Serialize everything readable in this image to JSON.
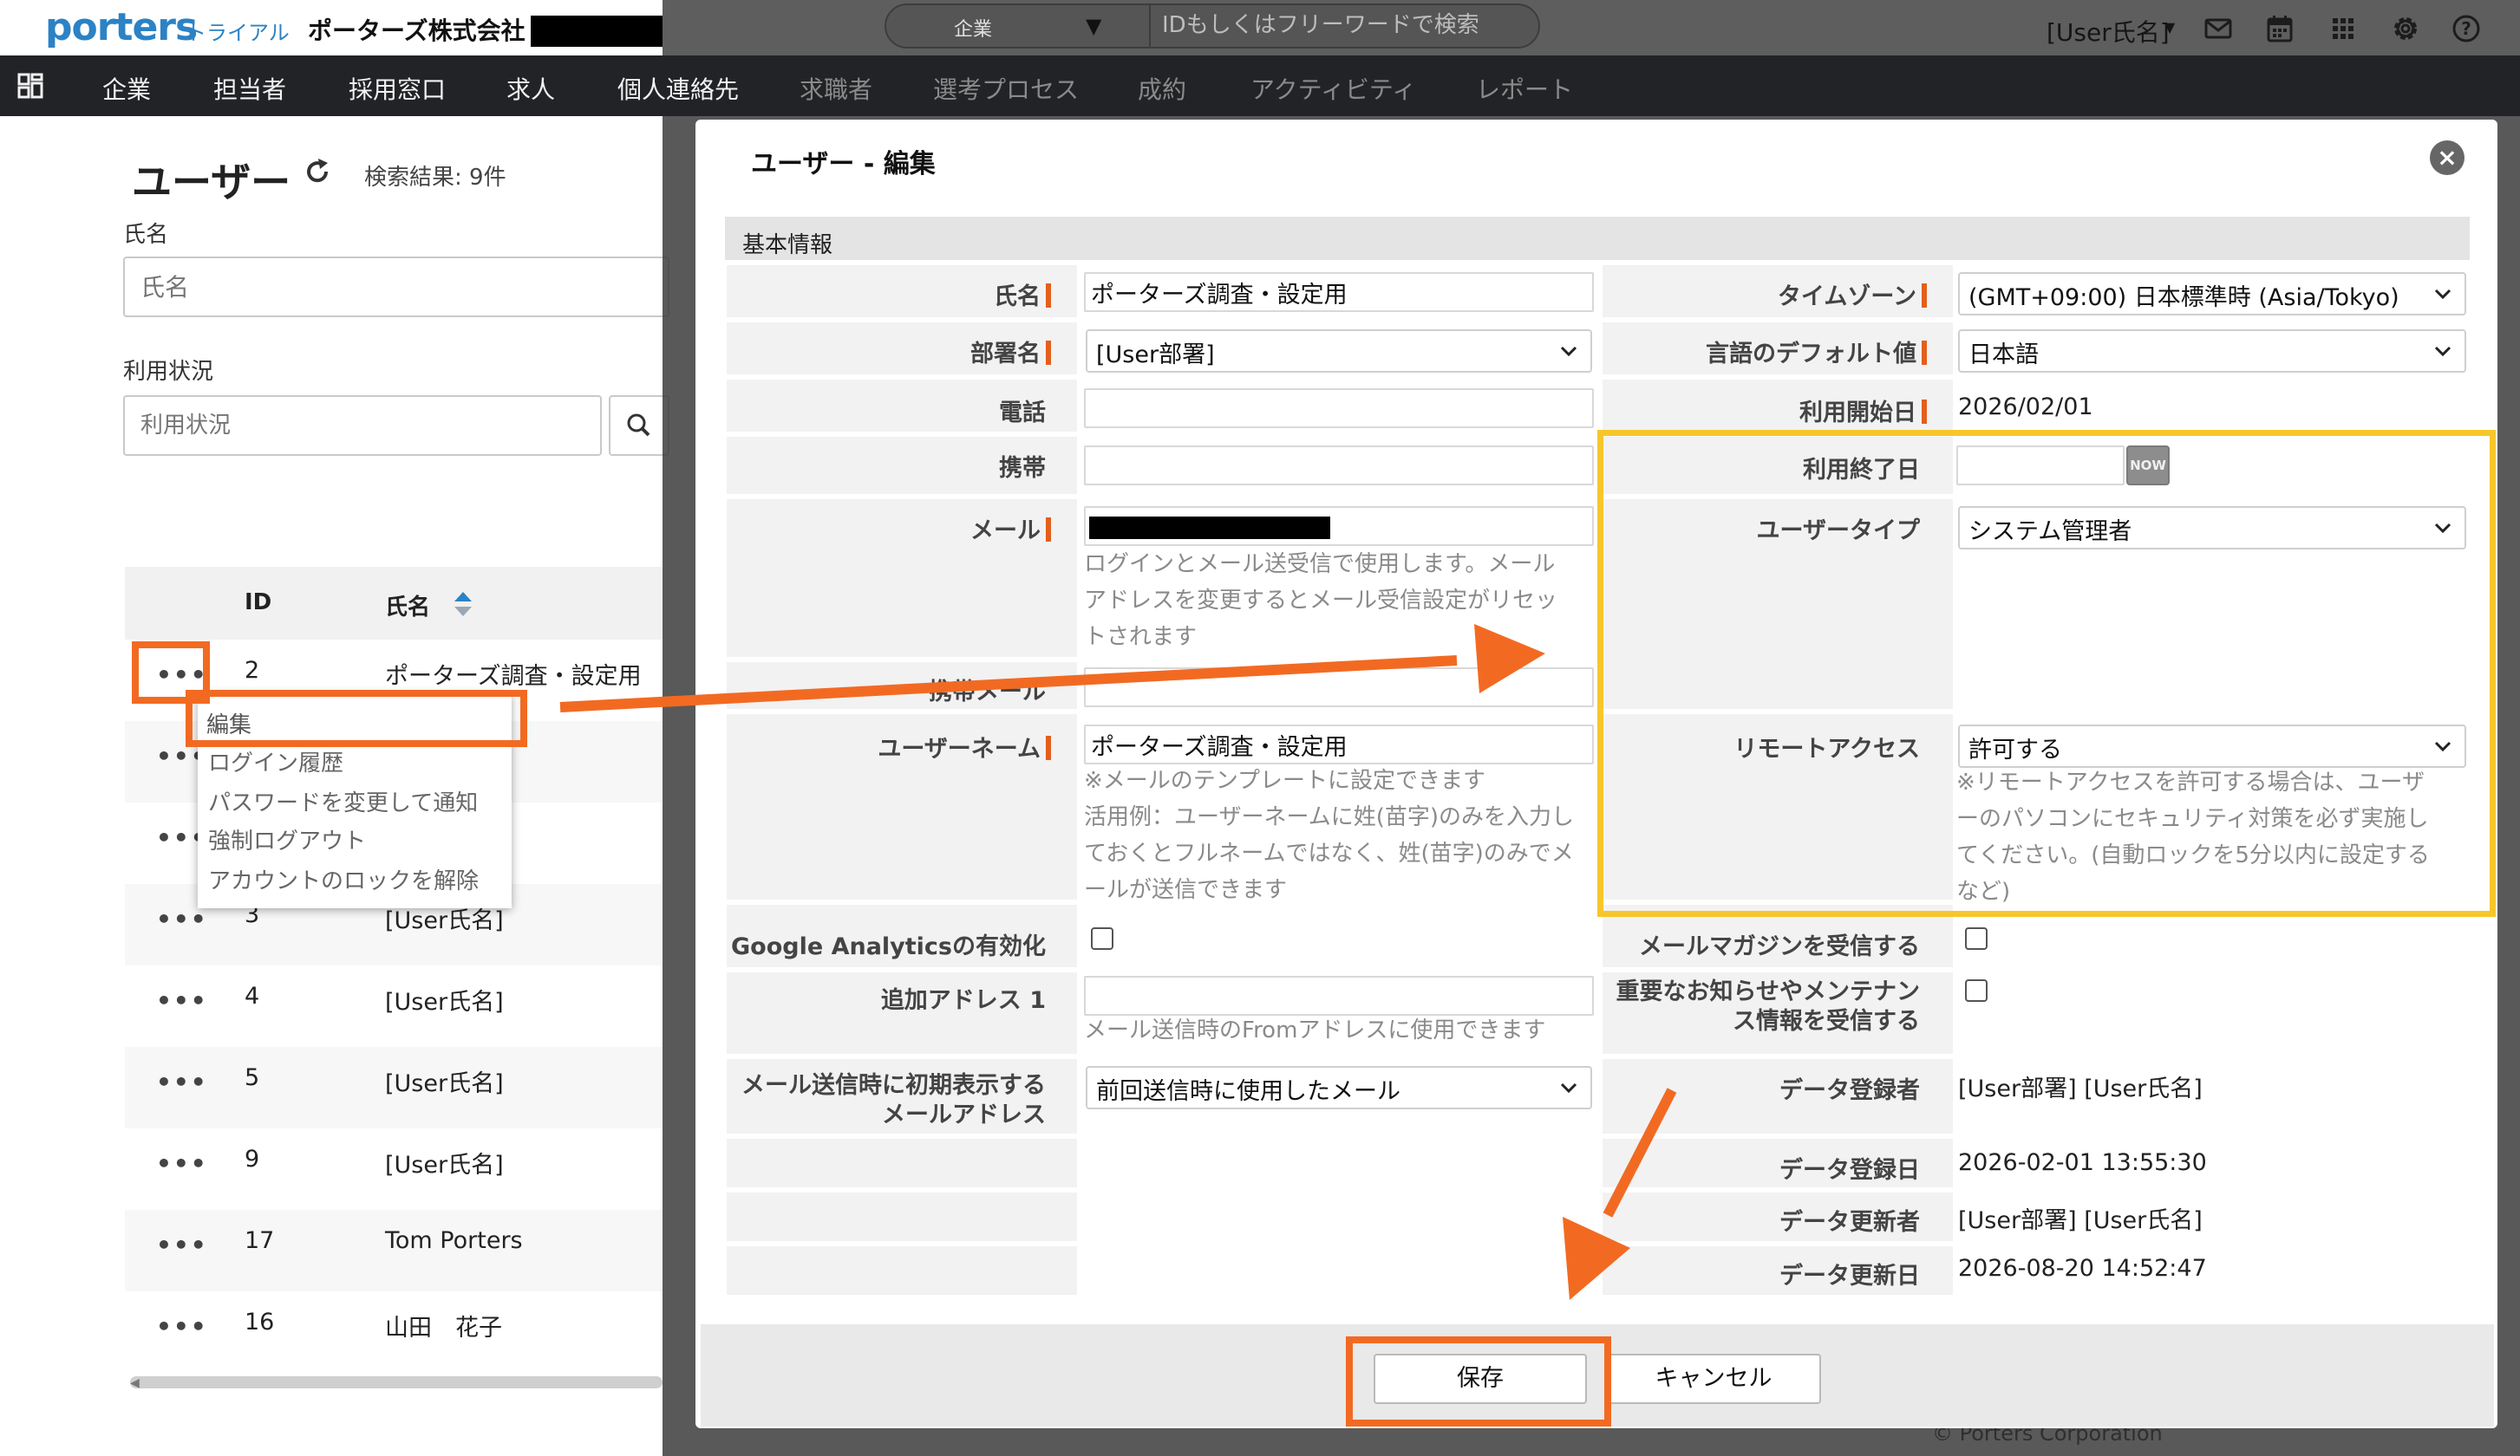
{
  "header": {
    "logo_text": "porters",
    "plan_label": "トライアル",
    "company_name": "ポーターズ株式会社 (",
    "company_paren": ")",
    "search_scope": "企業",
    "search_placeholder": "IDもしくはフリーワードで検索",
    "user_name": "[User氏名]",
    "icons": [
      "mail-icon",
      "calendar-icon",
      "apps-grid-icon",
      "gear-icon",
      "help-icon"
    ]
  },
  "nav": {
    "items": [
      "企業",
      "担当者",
      "採用窓口",
      "求人",
      "個人連絡先",
      "求職者",
      "選考プロセス",
      "成約",
      "アクティビティ",
      "レポート"
    ]
  },
  "user_list": {
    "title": "ユーザー",
    "result_count": "検索結果: 9件",
    "name_filter_label": "氏名",
    "name_filter_placeholder": "氏名",
    "status_filter_label": "利用状況",
    "status_filter_placeholder": "利用状況",
    "columns": {
      "id": "ID",
      "name": "氏名"
    },
    "rows": [
      {
        "id": "2",
        "name": "ポーターズ調査・設定用"
      },
      {
        "id": "",
        "name": ""
      },
      {
        "id": "",
        "name": ""
      },
      {
        "id": "3",
        "name": "[User氏名]"
      },
      {
        "id": "4",
        "name": "[User氏名]"
      },
      {
        "id": "5",
        "name": "[User氏名]"
      },
      {
        "id": "9",
        "name": "[User氏名]"
      },
      {
        "id": "17",
        "name": "Tom Porters"
      },
      {
        "id": "16",
        "name": "山田　花子"
      }
    ],
    "row_menu_label": "•••",
    "context_menu": [
      "編集",
      "ログイン履歴",
      "パスワードを変更して通知",
      "強制ログアウト",
      "アカウントのロックを解除"
    ]
  },
  "background_footer_text": "© Porters Corporation",
  "modal": {
    "title": "ユーザー - 編集",
    "close_glyph": "×",
    "section_title": "基本情報",
    "left": {
      "name_label": "氏名",
      "name_value": "ポーターズ調査・設定用",
      "dept_label": "部署名",
      "dept_value": "[User部署]",
      "phone_label": "電話",
      "mobile_label": "携帯",
      "email_label": "メール",
      "email_help": [
        "ログインとメール送受信で使用します。メール",
        "アドレスを変更するとメール受信設定がリセッ",
        "トされます"
      ],
      "mobile_email_label": "携帯メール",
      "username_label": "ユーザーネーム",
      "username_value": "ポーターズ調査・設定用",
      "username_help": [
        "※メールのテンプレートに設定できます",
        "活用例：ユーザーネームに姓(苗字)のみを入力し",
        "ておくとフルネームではなく、姓(苗字)のみでメ",
        "ールが送信できます"
      ],
      "ga_label": "Google Analyticsの有効化",
      "extra_address_label": "追加アドレス 1",
      "extra_address_help": "メール送信時のFromアドレスに使用できます",
      "initial_mail_label": [
        "メール送信時に初期表示する",
        "メールアドレス"
      ],
      "initial_mail_value": "前回送信時に使用したメール"
    },
    "right": {
      "timezone_label": "タイムゾーン",
      "timezone_value": "(GMT+09:00) 日本標準時 (Asia/Tokyo)",
      "language_label": "言語のデフォルト値",
      "language_value": "日本語",
      "start_date_label": "利用開始日",
      "start_date_value": "2026/02/01",
      "end_date_label": "利用終了日",
      "now_button": "NOW",
      "user_type_label": "ユーザータイプ",
      "user_type_value": "システム管理者",
      "remote_label": "リモートアクセス",
      "remote_value": "許可する",
      "remote_help": [
        "※リモートアクセスを許可する場合は、ユーザ",
        "ーのパソコンにセキュリティ対策を必ず実施し",
        "てください。(自動ロックを5分以内に設定する",
        "など)"
      ],
      "magazine_label": "メールマガジンを受信する",
      "notice_label": [
        "重要なお知らせやメンテナン",
        "ス情報を受信する"
      ],
      "registered_by_label": "データ登録者",
      "registered_by_value": "[User部署] [User氏名]",
      "registered_at_label": "データ登録日",
      "registered_at_value": "2026-02-01 13:55:30",
      "updated_by_label": "データ更新者",
      "updated_by_value": "[User部署] [User氏名]",
      "updated_at_label": "データ更新日",
      "updated_at_value": "2026-08-20 14:52:47"
    },
    "save_button": "保存",
    "cancel_button": "キャンセル"
  },
  "colors": {
    "brand_blue": "#2b82c5",
    "nav_bg": "#222327",
    "required_marker": "#e35f1c",
    "annotation_orange": "#f26a22",
    "annotation_yellow": "#f7c62b"
  }
}
